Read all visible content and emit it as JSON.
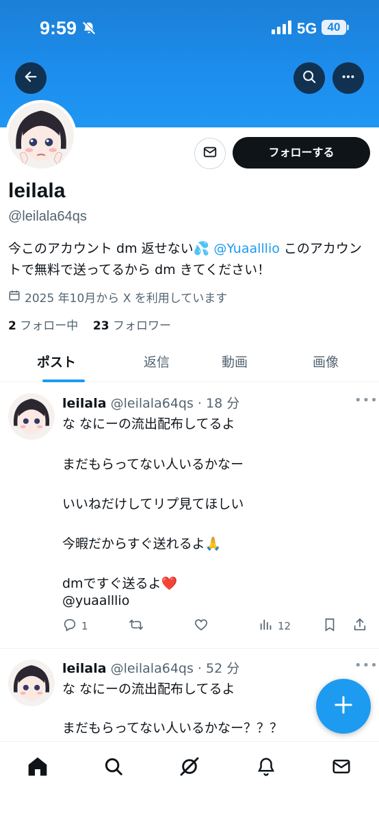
{
  "status_bar": {
    "time": "9:59",
    "network": "5G",
    "battery": "40"
  },
  "profile": {
    "display_name": "leilala",
    "handle": "@leilala64qs",
    "bio_before_mention": "今このアカウント dm 返せない💦 ",
    "bio_mention": "@Yuaalllio",
    "bio_after_mention": " このアカウントで無料で送ってるから dm きてください！",
    "joined": "2025 年10月から X を利用しています",
    "following_count": "2",
    "following_label": "フォロー中",
    "followers_count": "23",
    "followers_label": "フォロワー",
    "follow_button": "フォローする"
  },
  "tabs": [
    "ポスト",
    "返信",
    "動画",
    "画像"
  ],
  "tweets": [
    {
      "name": "leilala",
      "meta": "@leilala64qs · 18 分",
      "lines": [
        "な なにーの流出配布してるよ",
        "まだもらってない人いるかなー",
        "いいねだけしてリプ見てほしい",
        "今暇だからすぐ送れるよ🙏",
        "dmですぐ送るよ❤️"
      ],
      "mention": "@yuaalllio",
      "replies": "1",
      "retweets": "",
      "likes": "",
      "views": "12"
    },
    {
      "name": "leilala",
      "meta": "@leilala64qs · 52 分",
      "lines": [
        "な なにーの流出配布してるよ",
        "まだもらってない人いるかなー？？？"
      ]
    }
  ],
  "colors": {
    "accent": "#1d9bf0",
    "banner": "#1d8eef",
    "text": "#0f1419",
    "muted": "#536471"
  },
  "icons": {
    "status": [
      "bell-slash-icon",
      "signal-icon"
    ],
    "header": [
      "back-arrow-icon",
      "search-icon",
      "more-icon"
    ],
    "profile": [
      "mail-icon",
      "calendar-icon"
    ],
    "tweet_actions": [
      "reply-icon",
      "retweet-icon",
      "like-icon",
      "views-icon",
      "bookmark-icon",
      "share-icon"
    ],
    "nav": [
      "home-icon",
      "search-icon",
      "grok-icon",
      "notifications-icon",
      "messages-icon"
    ],
    "fab": "plus-icon"
  }
}
